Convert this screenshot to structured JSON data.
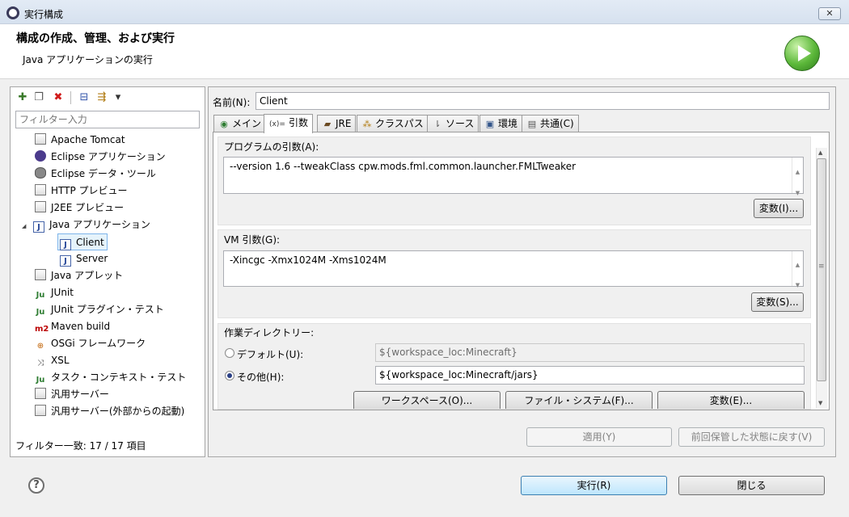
{
  "window": {
    "title": "実行構成",
    "close_glyph": "✕"
  },
  "header": {
    "title": "構成の作成、管理、および実行",
    "subtitle": "Java アプリケーションの実行",
    "icon": "run-icon"
  },
  "left": {
    "filter_placeholder": "フィルター入力",
    "toolbar": [
      {
        "icon": "new-config-icon",
        "glyph": "✚"
      },
      {
        "icon": "duplicate-icon",
        "glyph": "❐"
      },
      {
        "icon": "delete-icon",
        "glyph": "✖"
      },
      {
        "icon": "collapse-all-icon",
        "glyph": "⊟"
      },
      {
        "icon": "filter-icon",
        "glyph": "⇶"
      },
      {
        "icon": "dropdown-arrow-icon",
        "glyph": "▾"
      }
    ],
    "tree": [
      {
        "label": "Apache Tomcat",
        "icon": "doc-icon"
      },
      {
        "label": "Eclipse アプリケーション",
        "icon": "eclipse-icon"
      },
      {
        "label": "Eclipse データ・ツール",
        "icon": "database-icon"
      },
      {
        "label": "HTTP プレビュー",
        "icon": "doc-icon"
      },
      {
        "label": "J2EE プレビュー",
        "icon": "doc-icon"
      },
      {
        "label": "Java アプリケーション",
        "icon": "java-app-icon",
        "expanded": true,
        "toggle": "◢"
      },
      {
        "label": "Client",
        "icon": "java-app-icon",
        "selected": true
      },
      {
        "label": "Server",
        "icon": "java-app-icon"
      },
      {
        "label": "Java アプレット",
        "icon": "applet-icon"
      },
      {
        "label": "JUnit",
        "icon": "junit-icon"
      },
      {
        "label": "JUnit プラグイン・テスト",
        "icon": "junit-plugin-icon"
      },
      {
        "label": "Maven build",
        "icon": "maven-icon"
      },
      {
        "label": "OSGi フレームワーク",
        "icon": "osgi-icon"
      },
      {
        "label": "XSL",
        "icon": "xsl-icon"
      },
      {
        "label": "タスク・コンテキスト・テスト",
        "icon": "junit-plugin-icon"
      },
      {
        "label": "汎用サーバー",
        "icon": "doc-icon"
      },
      {
        "label": "汎用サーバー(外部からの起動)",
        "icon": "doc-icon"
      }
    ],
    "filter_status": "フィルター一致: 17 / 17 項目"
  },
  "right": {
    "name_label": "名前(N):",
    "name_value": "Client",
    "tabs": [
      {
        "label": "メイン",
        "icon": "main-tab-icon",
        "glyph": "◉"
      },
      {
        "label": "引数",
        "icon": "arguments-tab-icon",
        "glyph": "(x)=",
        "active": true
      },
      {
        "label": "JRE",
        "icon": "jre-tab-icon",
        "glyph": "▰"
      },
      {
        "label": "クラスパス",
        "icon": "classpath-tab-icon",
        "glyph": "⁂"
      },
      {
        "label": "ソース",
        "icon": "source-tab-icon",
        "glyph": "⇂"
      },
      {
        "label": "環境",
        "icon": "environment-tab-icon",
        "glyph": "▣"
      },
      {
        "label": "共通(C)",
        "icon": "common-tab-icon",
        "glyph": "▤"
      }
    ],
    "program_args": {
      "label": "プログラムの引数(A):",
      "value": "--version 1.6 --tweakClass cpw.mods.fml.common.launcher.FMLTweaker",
      "variables_button": "変数(I)..."
    },
    "vm_args": {
      "label": "VM 引数(G):",
      "value": "-Xincgc -Xmx1024M -Xms1024M",
      "variables_button": "変数(S)..."
    },
    "working_dir": {
      "label": "作業ディレクトリー:",
      "default_label": "デフォルト(U):",
      "default_value": "${workspace_loc:Minecraft}",
      "other_label": "その他(H):",
      "other_value": "${workspace_loc:Minecraft/jars}",
      "workspace_button": "ワークスペース(O)...",
      "filesystem_button": "ファイル・システム(F)...",
      "variables_button": "変数(E)..."
    },
    "apply_button": "適用(Y)",
    "revert_button": "前回保管した状態に戻す(V)"
  },
  "footer": {
    "help_glyph": "?",
    "run_button": "実行(R)",
    "close_button": "閉じる"
  },
  "scroll_glyphs": {
    "up": "▲",
    "down": "▼",
    "grip": "≡"
  },
  "colors": {
    "accent": "#3c7fb1",
    "selection": "#e5f3fb",
    "run_green": "#5cb83a"
  }
}
